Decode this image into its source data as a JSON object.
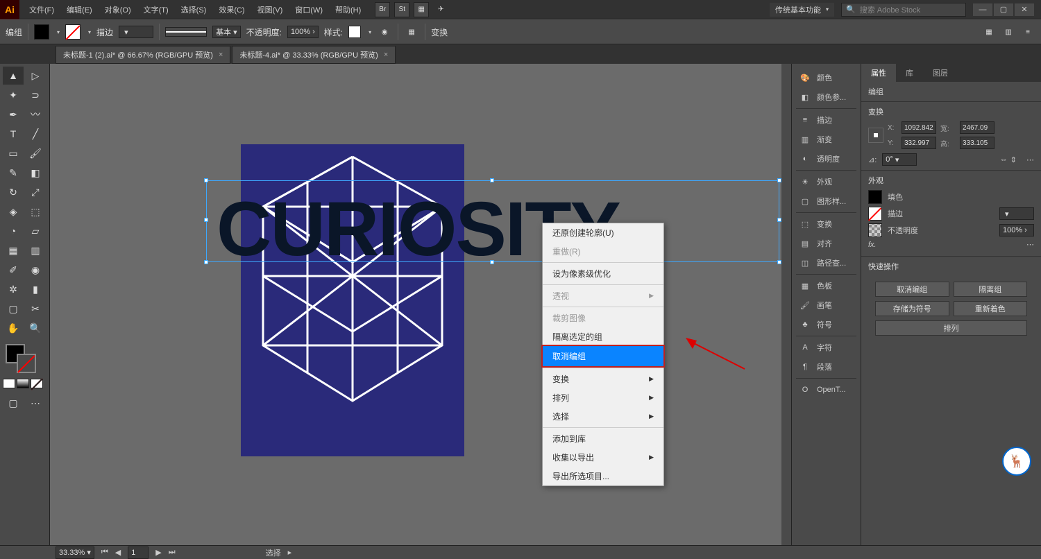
{
  "menubar": {
    "items": [
      "文件(F)",
      "编辑(E)",
      "对象(O)",
      "文字(T)",
      "选择(S)",
      "效果(C)",
      "视图(V)",
      "窗口(W)",
      "帮助(H)"
    ],
    "workspace": "传统基本功能",
    "search_placeholder": "搜索 Adobe Stock"
  },
  "control": {
    "label": "编组",
    "stroke_label": "描边",
    "stroke_value": "",
    "profile": "基本",
    "opacity_label": "不透明度:",
    "opacity_value": "100%",
    "style_label": "样式:",
    "transform_label": "变换"
  },
  "tabs": [
    {
      "title": "未标题-1 (2).ai* @ 66.67% (RGB/GPU 预览)"
    },
    {
      "title": "未标题-4.ai* @ 33.33% (RGB/GPU 预览)"
    }
  ],
  "canvas": {
    "text": "CURIOSITY"
  },
  "context_menu": {
    "items": [
      {
        "label": "还原创建轮廓(U)",
        "disabled": false
      },
      {
        "label": "重做(R)",
        "disabled": true
      },
      "sep",
      {
        "label": "设为像素级优化",
        "disabled": false
      },
      "sep",
      {
        "label": "透视",
        "arrow": true,
        "disabled": true
      },
      "sep",
      {
        "label": "裁剪图像",
        "disabled": true
      },
      {
        "label": "隔离选定的组",
        "disabled": false
      },
      {
        "label": "取消编组",
        "highlighted": true
      },
      "sep",
      {
        "label": "变换",
        "arrow": true
      },
      {
        "label": "排列",
        "arrow": true
      },
      {
        "label": "选择",
        "arrow": true
      },
      "sep",
      {
        "label": "添加到库"
      },
      {
        "label": "收集以导出",
        "arrow": true
      },
      {
        "label": "导出所选项目..."
      }
    ]
  },
  "right_panel": {
    "items": [
      "颜色",
      "颜色参...",
      null,
      "描边",
      "渐变",
      "透明度",
      null,
      "外观",
      "图形样...",
      null,
      "变换",
      "对齐",
      "路径查...",
      null,
      "色板",
      "画笔",
      "符号",
      null,
      "字符",
      "段落",
      null,
      "OpenT..."
    ]
  },
  "props": {
    "tabs": [
      "属性",
      "库",
      "图层"
    ],
    "selection": "编组",
    "transform": "变换",
    "x_lbl": "X:",
    "x": "1092.842",
    "w_lbl": "宽:",
    "w": "2467.09",
    "y_lbl": "Y:",
    "y": "332.997",
    "h_lbl": "高:",
    "h": "333.105",
    "angle": "0°",
    "appearance": "外观",
    "fill": "填色",
    "stroke": "描边",
    "opacity_l": "不透明度",
    "opacity_v": "100%",
    "fx": "fx.",
    "quick": "快速操作",
    "qa": [
      "取消编组",
      "隔离组",
      "存储为符号",
      "重新着色",
      "排列"
    ]
  },
  "status": {
    "zoom": "33.33%",
    "page": "1",
    "sel": "选择"
  }
}
